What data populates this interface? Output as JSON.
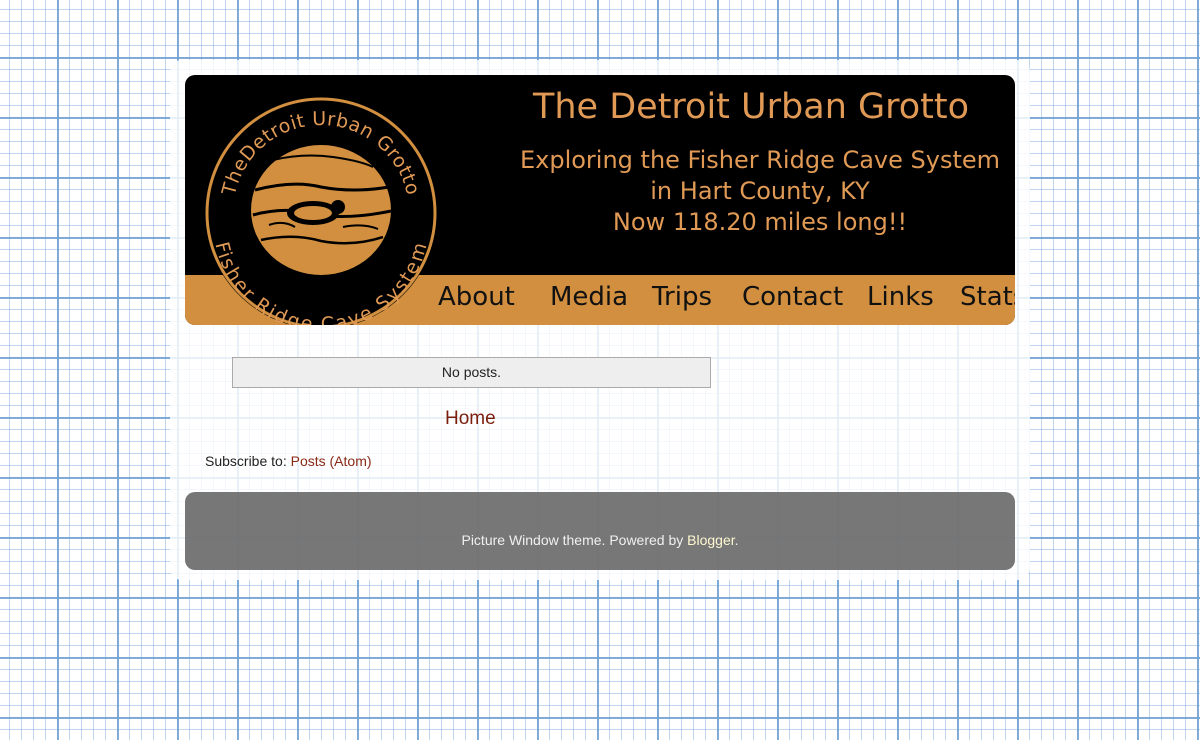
{
  "header": {
    "title": "The Detroit Urban Grotto",
    "tagline_lines": [
      "Exploring the Fisher Ridge Cave System",
      "in Hart County, KY",
      "Now 118.20 miles long!!"
    ],
    "logo": {
      "top_text": "TheDetroit Urban Grotto",
      "bottom_text": "Fisher Ridge Cave System"
    },
    "colors": {
      "background": "#000000",
      "accent": "#e09a55",
      "navbar": "#d18f3f"
    }
  },
  "nav": {
    "items": [
      "About",
      "Media",
      "Trips",
      "Contact",
      "Links",
      "Stats"
    ]
  },
  "main": {
    "no_posts": "No posts.",
    "home_link": "Home",
    "subscribe_label": "Subscribe to: ",
    "subscribe_link": "Posts (Atom)"
  },
  "footer": {
    "text_prefix": "Picture Window theme. Powered by ",
    "link": "Blogger",
    "text_suffix": "."
  }
}
